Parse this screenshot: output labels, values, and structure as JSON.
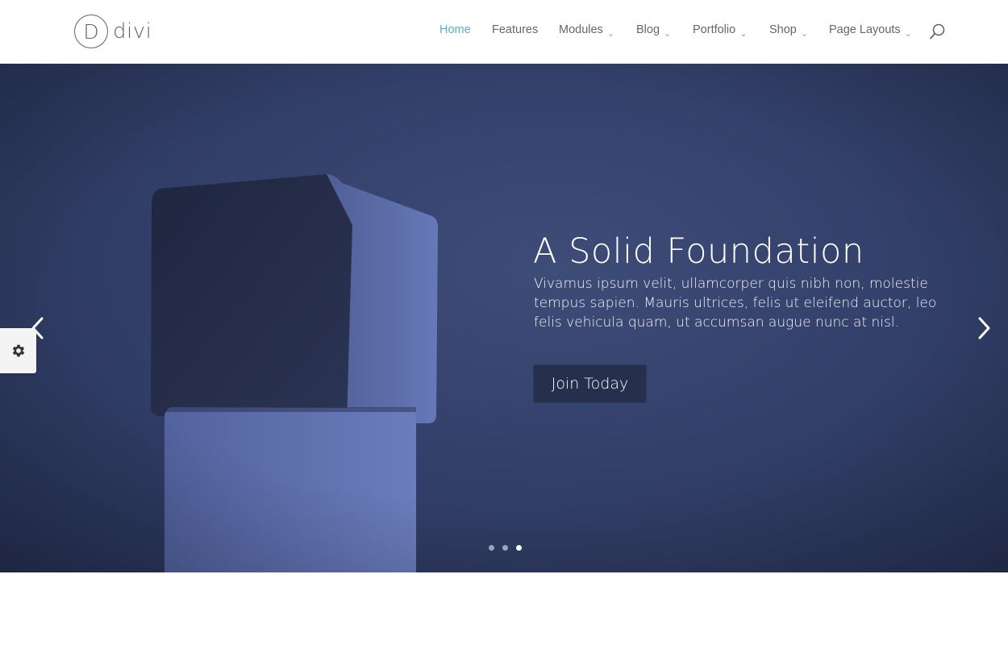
{
  "header": {
    "logo": {
      "mark": "D",
      "text": "divi",
      "icon": "divi-logo-icon"
    },
    "nav": [
      {
        "label": "Home",
        "active": true,
        "has_dropdown": false
      },
      {
        "label": "Features",
        "active": false,
        "has_dropdown": false
      },
      {
        "label": "Modules",
        "active": false,
        "has_dropdown": true
      },
      {
        "label": "Blog",
        "active": false,
        "has_dropdown": true
      },
      {
        "label": "Portfolio",
        "active": false,
        "has_dropdown": true
      },
      {
        "label": "Shop",
        "active": false,
        "has_dropdown": true
      },
      {
        "label": "Page Layouts",
        "active": false,
        "has_dropdown": true
      }
    ],
    "caret_glyph": "⌄",
    "search_icon": "search-icon"
  },
  "hero": {
    "title": "A Solid Foundation",
    "text": "Vivamus ipsum velit, ullamcorper quis nibh non, molestie tempus sapien. Mauris ultrices, felis ut eleifend auctor, leo felis vehicula quam, ut accumsan augue nunc at nisl.",
    "button_label": "Join Today",
    "prev_icon": "chevron-left-icon",
    "next_icon": "chevron-right-icon",
    "slides_total": 3,
    "active_slide": 3
  },
  "settings_icon": "gear-icon",
  "colors": {
    "accent": "#5aaec4",
    "nav_text": "#666666",
    "hero_bg": "#33406a",
    "button_bg": "#262f4c"
  }
}
